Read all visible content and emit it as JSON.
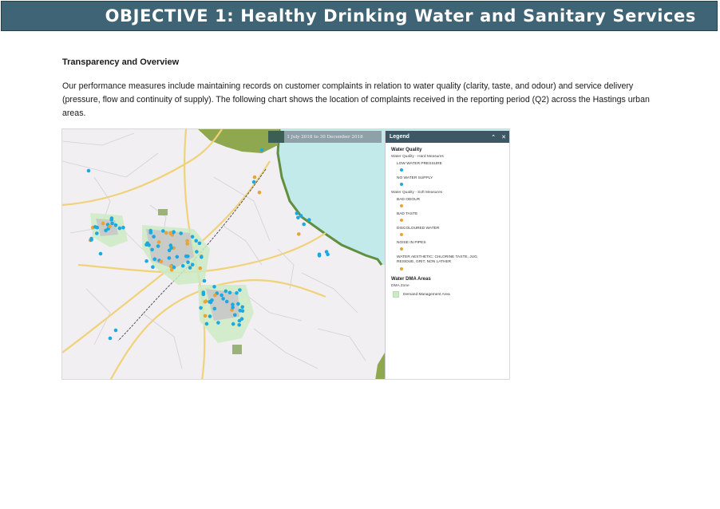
{
  "banner": {
    "title": "OBJECTIVE 1: Healthy Drinking Water and Sanitary Services"
  },
  "section": {
    "heading": "Transparency and Overview",
    "paragraph": "Our performance measures include maintaining records on customer complaints in relation to water quality (clarity, taste, and odour) and service delivery (pressure, flow and continuity of supply). The following chart shows the location of complaints received in the reporting period (Q2) across the Hastings urban areas."
  },
  "map": {
    "date_range": "1 July 2018 to 30 December 2018",
    "colors": {
      "land": "#f2eff2",
      "sea": "#c3eaea",
      "coast_green": "#8fa84f",
      "dma_zone": "#ccebc5",
      "urban": "#c8c8c8",
      "hard_measure_dot": "#1ba9e1",
      "soft_measure_dot": "#e8a43a"
    }
  },
  "legend": {
    "title": "Legend",
    "collapse_icon": "chevron-up-icon",
    "close_icon": "close-icon",
    "water_quality": {
      "heading": "Water Quality",
      "hard_heading": "Water Quality - Hard Measures",
      "hard_items": [
        "LOW WATER PRESSURE",
        "NO WATER SUPPLY"
      ],
      "soft_heading": "Water Quality - Soft Measures",
      "soft_items": [
        "BAD ODOUR",
        "BAD TASTE",
        "DISCOLOURED WATER",
        "NOISE IN PIPES",
        "WATER AESTHETIC: CHLORINE TASTE, JUG RESIDUE, GRIT, NON LATHER"
      ]
    },
    "dma": {
      "heading": "Water DMA Areas",
      "sub": "DMA Zone",
      "item": "Demand Management Area"
    }
  }
}
